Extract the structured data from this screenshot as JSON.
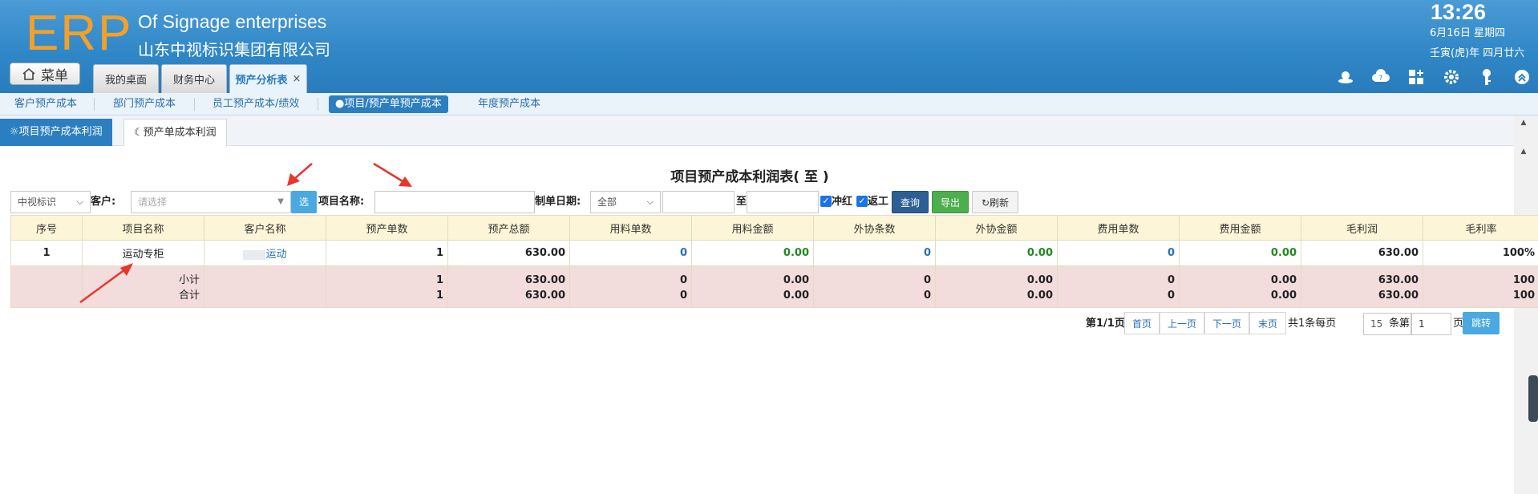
{
  "header": {
    "logo": "ERP",
    "company_en": "Of Signage enterprises",
    "company_cn": "山东中视标识集团有限公司",
    "time": "13:26",
    "date": "6月16日 星期四",
    "lunar": "壬寅(虎)年 四月廿六",
    "menu_label": "菜单",
    "tabs": [
      {
        "label": "我的桌面"
      },
      {
        "label": "财务中心"
      },
      {
        "label": "预产分析表",
        "close": "×"
      }
    ],
    "tool_icons": [
      "user-hat-icon",
      "cloud-help-icon",
      "grid-add-icon",
      "gear-icon",
      "key-icon",
      "collapse-up-icon"
    ]
  },
  "subnav": [
    {
      "label": "客户预产成本"
    },
    {
      "label": "部门预产成本"
    },
    {
      "label": "员工预产成本/绩效"
    },
    {
      "label": "●项目/预产单预产成本"
    },
    {
      "label": "年度预产成本"
    }
  ],
  "pagetabs": [
    {
      "label": "项目预产成本利润"
    },
    {
      "label": "预产单成本利润"
    }
  ],
  "report": {
    "title": "项目预产成本利润表( 至 )",
    "filters": {
      "company_select": "中视标识",
      "customer_label": "客户:",
      "customer_placeholder": "请选择",
      "choose_btn": "选",
      "project_label": "项目名称:",
      "project_value": "",
      "date_label": "制单日期:",
      "date_select": "全部",
      "date_from": "",
      "to_label": "至",
      "date_to": "",
      "chk_red": "冲红",
      "chk_rework": "返工",
      "query_btn": "查询",
      "export_btn": "导出",
      "refresh_btn": "刷新"
    },
    "columns": [
      "序号",
      "项目名称",
      "客户名称",
      "预产单数",
      "预产总额",
      "用料单数",
      "用料金额",
      "外协条数",
      "外协金额",
      "费用单数",
      "费用金额",
      "毛利润",
      "毛利率"
    ],
    "rows": [
      {
        "no": "1",
        "project": "运动专柜",
        "customer": "运动",
        "orders": "1",
        "total": "630.00",
        "mat_count": "0",
        "mat_amount": "0.00",
        "out_count": "0",
        "out_amount": "0.00",
        "fee_count": "0",
        "fee_amount": "0.00",
        "profit": "630.00",
        "rate": "100%"
      }
    ],
    "subtotal": {
      "label": "小计",
      "orders": "1",
      "total": "630.00",
      "mat_count": "0",
      "mat_amount": "0.00",
      "out_count": "0",
      "out_amount": "0.00",
      "fee_count": "0",
      "fee_amount": "0.00",
      "profit": "630.00",
      "rate": "100"
    },
    "grandtotal": {
      "label": "合计",
      "orders": "1",
      "total": "630.00",
      "mat_count": "0",
      "mat_amount": "0.00",
      "out_count": "0",
      "out_amount": "0.00",
      "fee_count": "0",
      "fee_amount": "0.00",
      "profit": "630.00",
      "rate": "100"
    }
  },
  "pager": {
    "page_info": "第1/1页",
    "first": "首页",
    "prev": "上一页",
    "next": "下一页",
    "last": "末页",
    "total_prefix": "共1条每页",
    "page_size": "15",
    "page_suffix": "条第",
    "page_input": "1",
    "page_unit": "页",
    "go_btn": "跳转"
  },
  "colors": {
    "header_blue": "#2f86c6",
    "logo_orange": "#f5a028",
    "annotation_red": "#e8362e"
  }
}
